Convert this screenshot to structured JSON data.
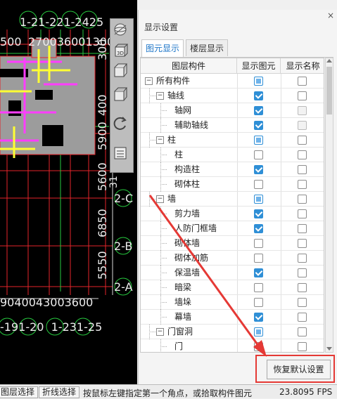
{
  "cad": {
    "top_labels": [
      "1-21-221-2425",
      "500",
      "270036001300"
    ],
    "left_dims": [
      "300",
      "400",
      "5900",
      "5600",
      "6850",
      "5550"
    ],
    "axis_labels": [
      "2-C",
      "2-B",
      "2-A"
    ],
    "bottom_dims": "9040043003600",
    "bottom_labels": "-191-20  1-231-25",
    "small_label": "31"
  },
  "colors": {
    "grid_red": "#e5252a",
    "grid_green": "#27c93f",
    "magenta": "#ff3cff",
    "yellow": "#ffff33",
    "check_blue": "#2f8fd6",
    "highlight_red": "#e53935"
  },
  "view_tools": [
    "sphere-view-icon",
    "3d-box-icon",
    "cube-front-icon",
    "cube-side-icon",
    "rotate-icon",
    "view-settings-icon"
  ],
  "panel": {
    "title": "显示设置",
    "close": "×",
    "tabs": [
      "图元显示",
      "楼层显示"
    ],
    "columns": [
      "图层构件",
      "显示图元",
      "显示名称"
    ],
    "rows": [
      {
        "label": "所有构件",
        "level": 0,
        "expand": "−",
        "show": "partial",
        "name": "off"
      },
      {
        "label": "轴线",
        "level": 1,
        "expand": "−",
        "show": "on",
        "name": "off"
      },
      {
        "label": "轴网",
        "level": 2,
        "show": "on",
        "name": "dis"
      },
      {
        "label": "辅助轴线",
        "level": 2,
        "show": "on",
        "name": "dis"
      },
      {
        "label": "柱",
        "level": 1,
        "expand": "−",
        "show": "partial",
        "name": "off"
      },
      {
        "label": "柱",
        "level": 2,
        "show": "off",
        "name": "off"
      },
      {
        "label": "构造柱",
        "level": 2,
        "show": "on",
        "name": "off"
      },
      {
        "label": "砌体柱",
        "level": 2,
        "show": "off",
        "name": "off"
      },
      {
        "label": "墙",
        "level": 1,
        "expand": "−",
        "show": "partial",
        "name": "off"
      },
      {
        "label": "剪力墙",
        "level": 2,
        "show": "on",
        "name": "off"
      },
      {
        "label": "人防门框墙",
        "level": 2,
        "show": "on",
        "name": "off"
      },
      {
        "label": "砌体墙",
        "level": 2,
        "show": "off",
        "name": "off"
      },
      {
        "label": "砌体加筋",
        "level": 2,
        "show": "off",
        "name": "off"
      },
      {
        "label": "保温墙",
        "level": 2,
        "show": "on",
        "name": "off"
      },
      {
        "label": "暗梁",
        "level": 2,
        "show": "off",
        "name": "off"
      },
      {
        "label": "墙垛",
        "level": 2,
        "show": "off",
        "name": "off"
      },
      {
        "label": "幕墙",
        "level": 2,
        "show": "on",
        "name": "off"
      },
      {
        "label": "门窗洞",
        "level": 1,
        "expand": "−",
        "show": "partial",
        "name": "off"
      },
      {
        "label": "门",
        "level": 2,
        "show": "off",
        "name": "off"
      }
    ],
    "restore_button": "恢复默认设置"
  },
  "status": {
    "btn_layer": "图层选择",
    "btn_polyline": "折线选择",
    "hint": "按鼠标左键指定第一个角点，或拾取构件图元",
    "fps": "23.8095 FPS"
  }
}
